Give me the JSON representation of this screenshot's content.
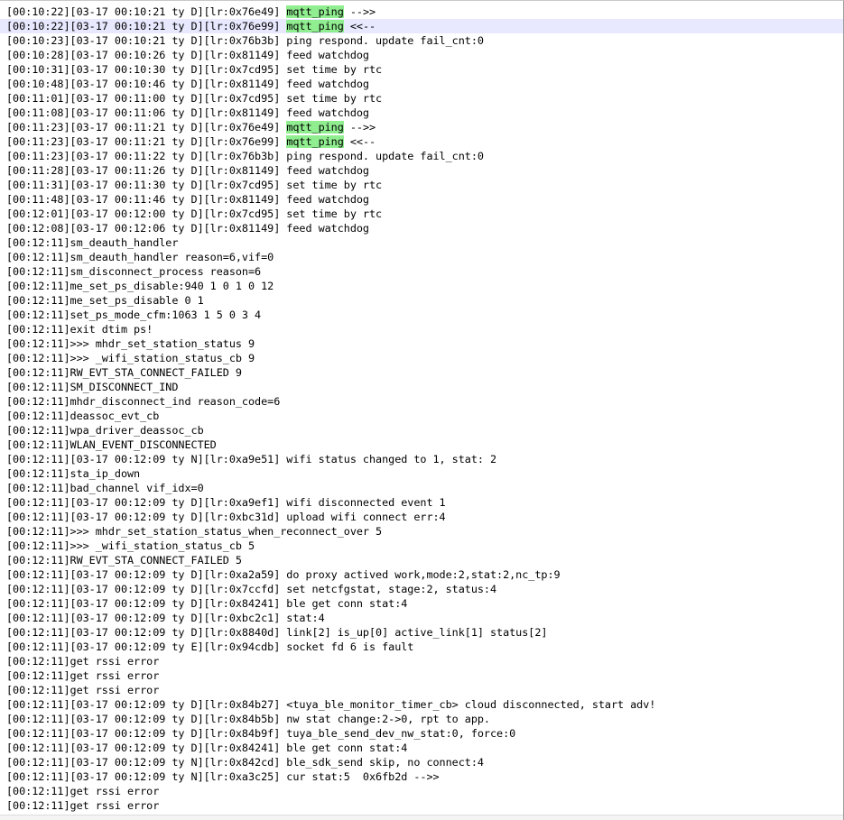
{
  "editor": {
    "current_line_index": 1,
    "highlight_color": "#90ee90",
    "current_line_color": "#e8e8ff",
    "lines": [
      {
        "parts": [
          "[00:10:22][03-17 00:10:21 ty D][lr:0x76e49] ",
          {
            "h": "mqtt_ping"
          },
          " -->>"
        ]
      },
      {
        "parts": [
          "[00:10:22][03-17 00:10:21 ty D][lr:0x76e99] ",
          {
            "h": "mqtt_ping"
          },
          " <<--"
        ]
      },
      {
        "parts": [
          "[00:10:23][03-17 00:10:21 ty D][lr:0x76b3b] ping respond. update fail_cnt:0"
        ]
      },
      {
        "parts": [
          "[00:10:28][03-17 00:10:26 ty D][lr:0x81149] feed watchdog"
        ]
      },
      {
        "parts": [
          "[00:10:31][03-17 00:10:30 ty D][lr:0x7cd95] set time by rtc"
        ]
      },
      {
        "parts": [
          "[00:10:48][03-17 00:10:46 ty D][lr:0x81149] feed watchdog"
        ]
      },
      {
        "parts": [
          "[00:11:01][03-17 00:11:00 ty D][lr:0x7cd95] set time by rtc"
        ]
      },
      {
        "parts": [
          "[00:11:08][03-17 00:11:06 ty D][lr:0x81149] feed watchdog"
        ]
      },
      {
        "parts": [
          "[00:11:23][03-17 00:11:21 ty D][lr:0x76e49] ",
          {
            "h": "mqtt_ping"
          },
          " -->>"
        ]
      },
      {
        "parts": [
          "[00:11:23][03-17 00:11:21 ty D][lr:0x76e99] ",
          {
            "h": "mqtt_ping"
          },
          " <<--"
        ]
      },
      {
        "parts": [
          "[00:11:23][03-17 00:11:22 ty D][lr:0x76b3b] ping respond. update fail_cnt:0"
        ]
      },
      {
        "parts": [
          "[00:11:28][03-17 00:11:26 ty D][lr:0x81149] feed watchdog"
        ]
      },
      {
        "parts": [
          "[00:11:31][03-17 00:11:30 ty D][lr:0x7cd95] set time by rtc"
        ]
      },
      {
        "parts": [
          "[00:11:48][03-17 00:11:46 ty D][lr:0x81149] feed watchdog"
        ]
      },
      {
        "parts": [
          "[00:12:01][03-17 00:12:00 ty D][lr:0x7cd95] set time by rtc"
        ]
      },
      {
        "parts": [
          "[00:12:08][03-17 00:12:06 ty D][lr:0x81149] feed watchdog"
        ]
      },
      {
        "parts": [
          "[00:12:11]sm_deauth_handler"
        ]
      },
      {
        "parts": [
          "[00:12:11]sm_deauth_handler reason=6,vif=0"
        ]
      },
      {
        "parts": [
          "[00:12:11]sm_disconnect_process reason=6"
        ]
      },
      {
        "parts": [
          "[00:12:11]me_set_ps_disable:940 1 0 1 0 12"
        ]
      },
      {
        "parts": [
          "[00:12:11]me_set_ps_disable 0 1"
        ]
      },
      {
        "parts": [
          "[00:12:11]set_ps_mode_cfm:1063 1 5 0 3 4"
        ]
      },
      {
        "parts": [
          "[00:12:11]exit dtim ps!"
        ]
      },
      {
        "parts": [
          "[00:12:11]>>> mhdr_set_station_status 9"
        ]
      },
      {
        "parts": [
          "[00:12:11]>>> _wifi_station_status_cb 9"
        ]
      },
      {
        "parts": [
          "[00:12:11]RW_EVT_STA_CONNECT_FAILED 9"
        ]
      },
      {
        "parts": [
          "[00:12:11]SM_DISCONNECT_IND"
        ]
      },
      {
        "parts": [
          "[00:12:11]mhdr_disconnect_ind reason_code=6"
        ]
      },
      {
        "parts": [
          "[00:12:11]deassoc_evt_cb"
        ]
      },
      {
        "parts": [
          "[00:12:11]wpa_driver_deassoc_cb"
        ]
      },
      {
        "parts": [
          "[00:12:11]WLAN_EVENT_DISCONNECTED"
        ]
      },
      {
        "parts": [
          "[00:12:11][03-17 00:12:09 ty N][lr:0xa9e51] wifi status changed to 1, stat: 2"
        ]
      },
      {
        "parts": [
          "[00:12:11]sta_ip_down"
        ]
      },
      {
        "parts": [
          "[00:12:11]bad_channel vif_idx=0"
        ]
      },
      {
        "parts": [
          "[00:12:11][03-17 00:12:09 ty D][lr:0xa9ef1] wifi disconnected event 1"
        ]
      },
      {
        "parts": [
          "[00:12:11][03-17 00:12:09 ty D][lr:0xbc31d] upload wifi connect err:4"
        ]
      },
      {
        "parts": [
          "[00:12:11]>>> mhdr_set_station_status_when_reconnect_over 5"
        ]
      },
      {
        "parts": [
          "[00:12:11]>>> _wifi_station_status_cb 5"
        ]
      },
      {
        "parts": [
          "[00:12:11]RW_EVT_STA_CONNECT_FAILED 5"
        ]
      },
      {
        "parts": [
          "[00:12:11][03-17 00:12:09 ty D][lr:0xa2a59] do proxy actived work,mode:2,stat:2,nc_tp:9"
        ]
      },
      {
        "parts": [
          "[00:12:11][03-17 00:12:09 ty D][lr:0x7ccfd] set netcfgstat, stage:2, status:4"
        ]
      },
      {
        "parts": [
          "[00:12:11][03-17 00:12:09 ty D][lr:0x84241] ble get conn stat:4"
        ]
      },
      {
        "parts": [
          "[00:12:11][03-17 00:12:09 ty D][lr:0xbc2c1] stat:4"
        ]
      },
      {
        "parts": [
          "[00:12:11][03-17 00:12:09 ty D][lr:0x8840d] link[2] is_up[0] active_link[1] status[2]"
        ]
      },
      {
        "parts": [
          "[00:12:11][03-17 00:12:09 ty E][lr:0x94cdb] socket fd 6 is fault"
        ]
      },
      {
        "parts": [
          "[00:12:11]get rssi error"
        ]
      },
      {
        "parts": [
          "[00:12:11]get rssi error"
        ]
      },
      {
        "parts": [
          "[00:12:11]get rssi error"
        ]
      },
      {
        "parts": [
          "[00:12:11][03-17 00:12:09 ty D][lr:0x84b27] <tuya_ble_monitor_timer_cb> cloud disconnected, start adv!"
        ]
      },
      {
        "parts": [
          "[00:12:11][03-17 00:12:09 ty D][lr:0x84b5b] nw stat change:2->0, rpt to app."
        ]
      },
      {
        "parts": [
          "[00:12:11][03-17 00:12:09 ty D][lr:0x84b9f] tuya_ble_send_dev_nw_stat:0, force:0"
        ]
      },
      {
        "parts": [
          "[00:12:11][03-17 00:12:09 ty D][lr:0x84241] ble get conn stat:4"
        ]
      },
      {
        "parts": [
          "[00:12:11][03-17 00:12:09 ty N][lr:0x842cd] ble_sdk_send skip, no connect:4"
        ]
      },
      {
        "parts": [
          "[00:12:11][03-17 00:12:09 ty N][lr:0xa3c25] cur stat:5  0x6fb2d -->>"
        ]
      },
      {
        "parts": [
          "[00:12:11]get rssi error"
        ]
      },
      {
        "parts": [
          "[00:12:11]get rssi error"
        ]
      }
    ]
  }
}
